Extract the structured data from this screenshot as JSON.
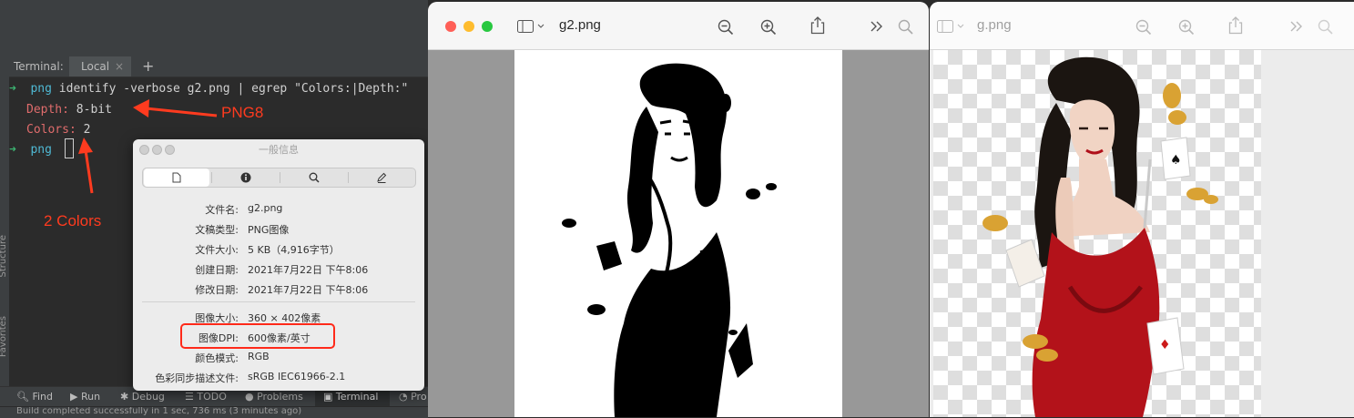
{
  "ide": {
    "terminal_label": "Terminal:",
    "tab_local": "Local",
    "tab_close": "×",
    "add_tab": "+",
    "side_labels": [
      "Structure",
      "Favorites"
    ],
    "lines": {
      "prompt_arrow": "➜",
      "prompt_dir": "png",
      "command": "identify -verbose g2.png | egrep \"Colors:|Depth:\"",
      "depth_key": "Depth:",
      "depth_val": "8-bit",
      "colors_key": "Colors:",
      "colors_val": "2"
    },
    "annotations": {
      "png8": "PNG8",
      "two_colors": "2 Colors"
    },
    "bottom_tabs": [
      "Find",
      "Run",
      "Debug",
      "TODO",
      "Problems",
      "Terminal",
      "Pro"
    ],
    "status": "Build completed successfully in 1 sec, 736 ms (3 minutes ago)"
  },
  "info": {
    "title": "一般信息",
    "rows": [
      {
        "label": "文件名:",
        "value": "g2.png"
      },
      {
        "label": "文稿类型:",
        "value": "PNG图像"
      },
      {
        "label": "文件大小:",
        "value": "5 KB（4,916字节）"
      },
      {
        "label": "创建日期:",
        "value": "2021年7月22日 下午8:06"
      },
      {
        "label": "修改日期:",
        "value": "2021年7月22日 下午8:06"
      }
    ],
    "rows2": [
      {
        "label": "图像大小:",
        "value": "360 × 402像素"
      },
      {
        "label": "图像DPI:",
        "value": "600像素/英寸"
      },
      {
        "label": "颜色模式:",
        "value": "RGB"
      },
      {
        "label": "色彩同步描述文件:",
        "value": "sRGB IEC61966-2.1"
      }
    ]
  },
  "preview1": {
    "title": "g2.png"
  },
  "preview2": {
    "title": "g.png"
  },
  "colors": {
    "annotation_red": "#ff3b1f",
    "close": "#ff5f57",
    "minimize": "#febc2e",
    "zoom": "#28c840"
  }
}
